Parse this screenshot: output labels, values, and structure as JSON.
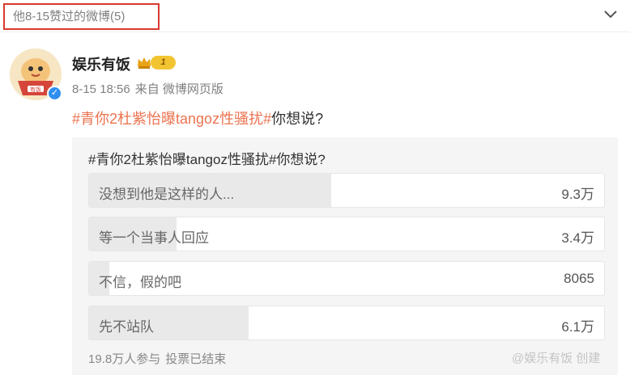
{
  "header": {
    "title": "他8-15赞过的微博(5)"
  },
  "post": {
    "username": "娱乐有饭",
    "level": "1",
    "avatar_text": "有饭",
    "date": "8-15 18:56",
    "source": "来自 微博网页版",
    "hashtag": "#青你2杜紫怡曝tangoz性骚扰#",
    "text": "你想说?"
  },
  "poll": {
    "question": "#青你2杜紫怡曝tangoz性骚扰#你想说?",
    "options": [
      {
        "label": "没想到他是这样的人...",
        "count": "9.3万",
        "share": 0.47
      },
      {
        "label": "等一个当事人回应",
        "count": "3.4万",
        "share": 0.17
      },
      {
        "label": "不信，假的吧",
        "count": "8065",
        "share": 0.04
      },
      {
        "label": "先不站队",
        "count": "6.1万",
        "share": 0.31
      }
    ],
    "participants": "19.8万人参与",
    "status": "投票已结束"
  },
  "watermark": "@娱乐有饭 创建"
}
